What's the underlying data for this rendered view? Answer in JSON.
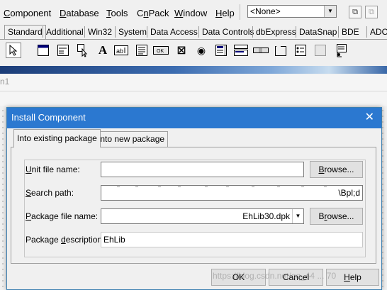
{
  "menu": {
    "items": [
      "Component",
      "Database",
      "Tools",
      "CnPack",
      "Window",
      "Help"
    ],
    "combo_value": "<None>"
  },
  "palette": {
    "tabs": [
      "Standard",
      "Additional",
      "Win32",
      "System",
      "Data Access",
      "Data Controls",
      "dbExpress",
      "DataSnap",
      "BDE",
      "ADO"
    ],
    "active_tab": "Standard",
    "icons": [
      "pointer-icon",
      "frame-icon",
      "main-menu-icon",
      "popup-menu-icon",
      "label-icon",
      "edit-icon",
      "memo-icon",
      "button-icon",
      "checkbox-icon",
      "radiobutton-icon",
      "listbox-icon",
      "combobox-icon",
      "scrollbar-icon",
      "groupbox-icon",
      "radiogroup-icon",
      "panel-icon",
      "actionlist-icon"
    ]
  },
  "designer": {
    "form_caption": "n1"
  },
  "dialog": {
    "title": "Install Component",
    "tabs": [
      "Into existing package",
      "Into new package"
    ],
    "active_tab": "Into existing package",
    "fields": {
      "unit": {
        "label": "Unit file name:",
        "value": ""
      },
      "search": {
        "label": "Search path:",
        "value": "\\Bpl;d"
      },
      "package": {
        "label": "Package file name:",
        "value": "EhLib30.dpk"
      },
      "description": {
        "label": "Package description:",
        "value": "EhLib"
      }
    },
    "buttons": {
      "browse1": "Browse...",
      "browse2": "Browse...",
      "ok": "OK",
      "cancel": "Cancel",
      "help": "Help"
    }
  },
  "watermark": "https://blog.csdn.net/qq_44 ... 70"
}
